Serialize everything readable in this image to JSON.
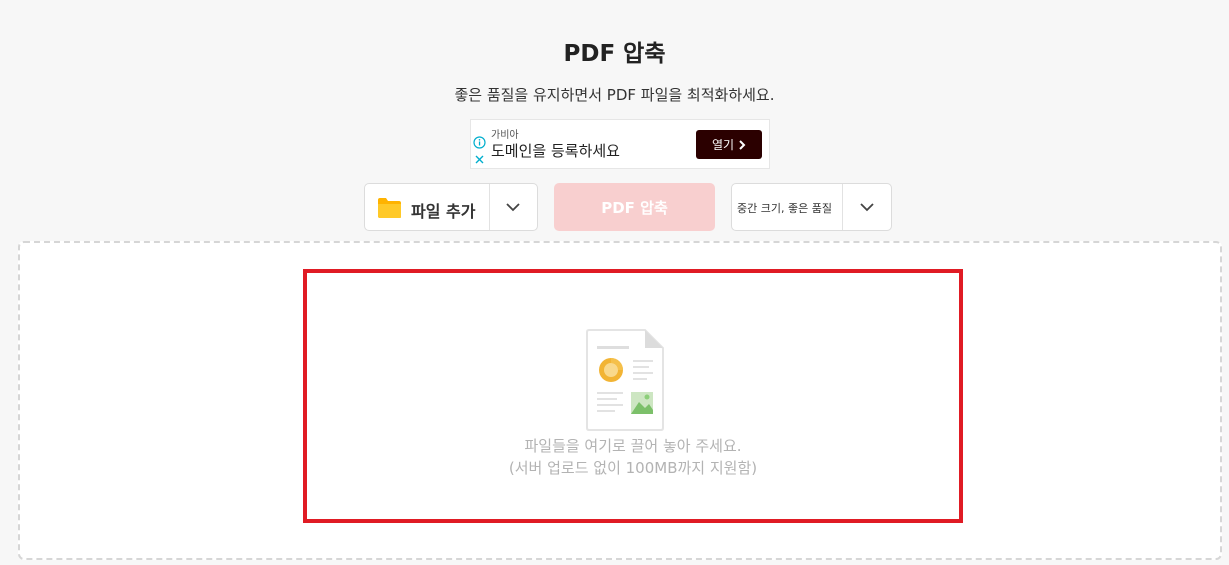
{
  "header": {
    "title": "PDF 압축",
    "subtitle": "좋은 품질을 유지하면서 PDF 파일을 최적화하세요."
  },
  "ad": {
    "brand": "가비아",
    "text": "도메인을 등록하세요",
    "open_label": "열기",
    "info_icon": "info-icon",
    "close_icon": "close-icon"
  },
  "toolbar": {
    "add_file_label": "파일 추가",
    "add_file_icon": "folder-icon",
    "compress_label": "PDF 압축",
    "quality_label": "중간 크기, 좋은 품질"
  },
  "dropzone": {
    "line1": "파일들을 여기로 끌어 놓아 주세요.",
    "line2": "(서버 업로드 없이 100MB까지 지원함)",
    "icon": "document-icon"
  },
  "colors": {
    "accent_disabled": "#f8cfcf",
    "highlight_border": "#e01b24",
    "ad_button": "#2b0000",
    "folder": "#ffc107"
  }
}
